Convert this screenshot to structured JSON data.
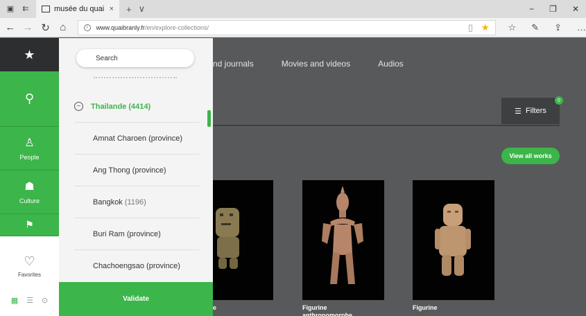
{
  "browser": {
    "tab_title": "musée du quai Branly -",
    "tab_close": "×",
    "tab_new": "+",
    "tab_menu": "∨",
    "url_host": "www.quaibranly.fr",
    "url_path": "/en/explore-collections/"
  },
  "sidebar": {
    "people_label": "People",
    "culture_label": "Culture",
    "favorites_label": "Favorites"
  },
  "filter_panel": {
    "search_placeholder": "Search",
    "items": [
      {
        "label": "Thailande",
        "count": "(4414)"
      },
      {
        "label": "Amnat Charoen (province)",
        "count": ""
      },
      {
        "label": "Ang Thong (province)",
        "count": ""
      },
      {
        "label": "Bangkok",
        "count": "(1196)"
      },
      {
        "label": "Buri Ram (province)",
        "count": ""
      },
      {
        "label": "Chachoengsao (province)",
        "count": ""
      }
    ],
    "validate_label": "Validate"
  },
  "main": {
    "tabs": [
      "nd journals",
      "Movies and videos",
      "Audios"
    ],
    "filters_label": "Filters",
    "filters_count": "0",
    "view_all_label": "View all works",
    "captions": [
      "e",
      "Figurine\nanthropomorphe",
      "Figurine"
    ]
  },
  "colors": {
    "accent": "#3cb54a",
    "page_bg": "#58595b",
    "dark": "#2c2e30"
  }
}
